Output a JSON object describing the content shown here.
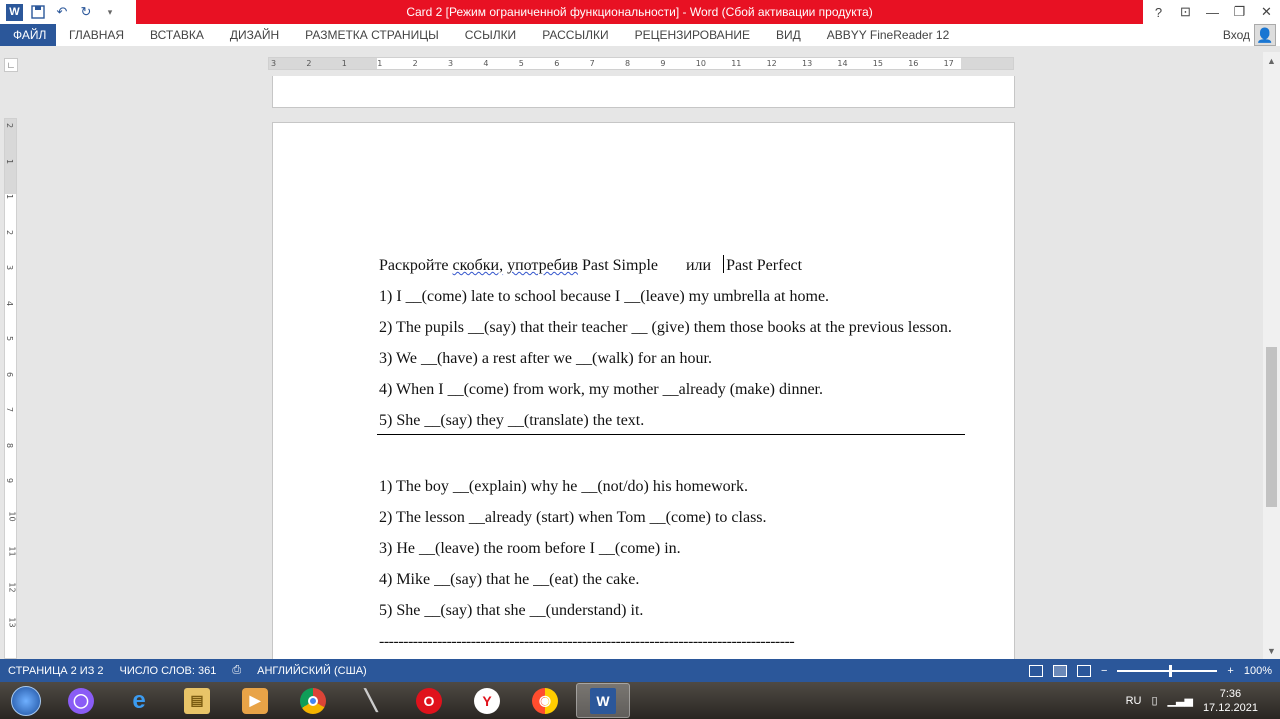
{
  "titlebar": {
    "title": "Card 2 [Режим ограниченной функциональности] -  Word (Сбой активации продукта)",
    "help": "?",
    "app_letter": "W"
  },
  "ribbon": {
    "file_tab": "ФАЙЛ",
    "tabs": [
      "ГЛАВНАЯ",
      "ВСТАВКА",
      "ДИЗАЙН",
      "РАЗМЕТКА СТРАНИЦЫ",
      "ССЫЛКИ",
      "РАССЫЛКИ",
      "РЕЦЕНЗИРОВАНИЕ",
      "ВИД",
      "ABBYY FineReader 12"
    ],
    "signin": "Вход"
  },
  "ruler": {
    "h_labels": [
      "3",
      "2",
      "1",
      "1",
      "2",
      "3",
      "4",
      "5",
      "6",
      "7",
      "8",
      "9",
      "10",
      "11",
      "12",
      "13",
      "14",
      "15",
      "16",
      "17"
    ],
    "v_labels": [
      "2",
      "1",
      "1",
      "2",
      "3",
      "4",
      "5",
      "6",
      "7",
      "8",
      "9",
      "10",
      "11",
      "12",
      "13"
    ]
  },
  "document": {
    "heading": {
      "pre": "Раскройте ",
      "w1": "скобки,",
      "mid": " ",
      "w2": "употребив",
      "post": " Past Simple       или",
      "after": "Past Perfect"
    },
    "group1": [
      "1) I __(come) late to school because I __(leave) my umbrella at home.",
      "2) The pupils __(say) that their teacher __ (give) them those books at the previous lesson.",
      "3) We __(have) a rest after we __(walk) for an hour.",
      "4) When I __(come) from work, my mother __already (make) dinner.",
      "5) She __(say) they __(translate) the text."
    ],
    "group2": [
      "1) The boy __(explain) why he __(not/do) his homework.",
      "2) The lesson __already (start) when Tom __(come) to class.",
      "3) He __(leave) the room before I __(come) in.",
      "4) Mike __(say) that he __(eat) the cake.",
      "5) She __(say) that she __(understand) it."
    ],
    "dashes": "--------------------------------------------------------------------------------------"
  },
  "statusbar": {
    "page": "СТРАНИЦА 2 ИЗ 2",
    "words": "ЧИСЛО СЛОВ: 361",
    "language": "АНГЛИЙСКИЙ (США)",
    "zoom": "100%"
  },
  "taskbar": {
    "apps": [
      "alice",
      "ie",
      "explorer",
      "media",
      "chrome",
      "microphone",
      "opera",
      "yandex",
      "browser",
      "word"
    ],
    "lang": "RU",
    "time": "7:36",
    "date": "17.12.2021"
  },
  "colors": {
    "accent": "#2b579a",
    "title_alert": "#e81123"
  }
}
